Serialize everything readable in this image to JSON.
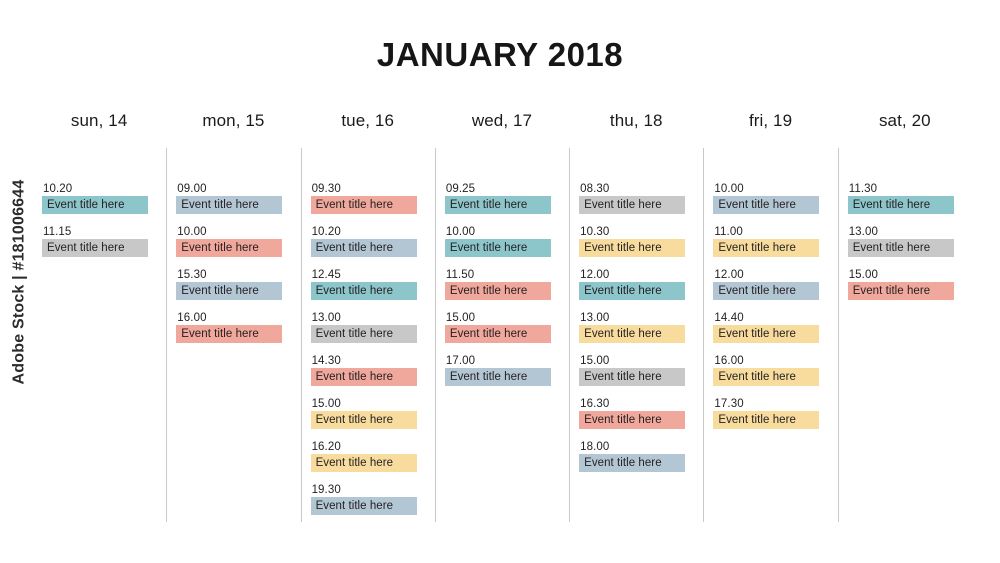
{
  "watermark": {
    "text": "Adobe Stock | #181006644"
  },
  "header": {
    "title": "JANUARY 2018"
  },
  "palette": {
    "teal": "#8cc5ca",
    "gray": "#c8c8c8",
    "blue": "#b3c6d4",
    "salmon": "#f0a79c",
    "yellow": "#f7dc9e",
    "divider": "#c9c9c9",
    "text": "#231f20",
    "background": "#ffffff"
  },
  "columns": [
    {
      "id": "sun-14",
      "label": "sun, 14",
      "events": [
        {
          "time": "10.20",
          "title": "Event title here",
          "color": "teal"
        },
        {
          "time": "11.15",
          "title": "Event title here",
          "color": "gray"
        }
      ]
    },
    {
      "id": "mon-15",
      "label": "mon, 15",
      "events": [
        {
          "time": "09.00",
          "title": "Event title here",
          "color": "blue"
        },
        {
          "time": "10.00",
          "title": "Event title here",
          "color": "salmon"
        },
        {
          "time": "15.30",
          "title": "Event title here",
          "color": "blue"
        },
        {
          "time": "16.00",
          "title": "Event title here",
          "color": "salmon"
        }
      ]
    },
    {
      "id": "tue-16",
      "label": "tue, 16",
      "events": [
        {
          "time": "09.30",
          "title": "Event title here",
          "color": "salmon"
        },
        {
          "time": "10.20",
          "title": "Event title here",
          "color": "blue"
        },
        {
          "time": "12.45",
          "title": "Event title here",
          "color": "teal"
        },
        {
          "time": "13.00",
          "title": "Event title here",
          "color": "gray"
        },
        {
          "time": "14.30",
          "title": "Event title here",
          "color": "salmon"
        },
        {
          "time": "15.00",
          "title": "Event title here",
          "color": "yellow"
        },
        {
          "time": "16.20",
          "title": "Event title here",
          "color": "yellow"
        },
        {
          "time": "19.30",
          "title": "Event title here",
          "color": "blue"
        }
      ]
    },
    {
      "id": "wed-17",
      "label": "wed, 17",
      "events": [
        {
          "time": "09.25",
          "title": "Event title here",
          "color": "teal"
        },
        {
          "time": "10.00",
          "title": "Event title here",
          "color": "teal"
        },
        {
          "time": "11.50",
          "title": "Event title here",
          "color": "salmon"
        },
        {
          "time": "15.00",
          "title": "Event title here",
          "color": "salmon"
        },
        {
          "time": "17.00",
          "title": "Event title here",
          "color": "blue"
        }
      ]
    },
    {
      "id": "thu-18",
      "label": "thu, 18",
      "events": [
        {
          "time": "08.30",
          "title": "Event title here",
          "color": "gray"
        },
        {
          "time": "10.30",
          "title": "Event title here",
          "color": "yellow"
        },
        {
          "time": "12.00",
          "title": "Event title here",
          "color": "teal"
        },
        {
          "time": "13.00",
          "title": "Event title here",
          "color": "yellow"
        },
        {
          "time": "15.00",
          "title": "Event title here",
          "color": "gray"
        },
        {
          "time": "16.30",
          "title": "Event title here",
          "color": "salmon"
        },
        {
          "time": "18.00",
          "title": "Event title here",
          "color": "blue"
        }
      ]
    },
    {
      "id": "fri-19",
      "label": "fri, 19",
      "events": [
        {
          "time": "10.00",
          "title": "Event title here",
          "color": "blue"
        },
        {
          "time": "11.00",
          "title": "Event title here",
          "color": "yellow"
        },
        {
          "time": "12.00",
          "title": "Event title here",
          "color": "blue"
        },
        {
          "time": "14.40",
          "title": "Event title here",
          "color": "yellow"
        },
        {
          "time": "16.00",
          "title": "Event title here",
          "color": "yellow"
        },
        {
          "time": "17.30",
          "title": "Event title here",
          "color": "yellow"
        }
      ]
    },
    {
      "id": "sat-20",
      "label": "sat, 20",
      "events": [
        {
          "time": "11.30",
          "title": "Event title here",
          "color": "teal"
        },
        {
          "time": "13.00",
          "title": "Event title here",
          "color": "gray"
        },
        {
          "time": "15.00",
          "title": "Event title here",
          "color": "salmon"
        }
      ]
    }
  ]
}
